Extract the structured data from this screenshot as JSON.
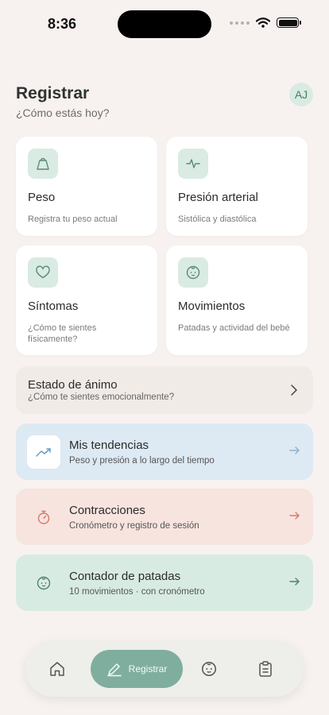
{
  "status": {
    "time": "8:36"
  },
  "header": {
    "title": "Registrar",
    "subtitle": "¿Cómo estás hoy?",
    "avatar": "AJ"
  },
  "grid": [
    {
      "title": "Peso",
      "desc": "Registra tu peso actual",
      "icon": "weight-icon"
    },
    {
      "title": "Presión arterial",
      "desc": "Sistólica y diastólica",
      "icon": "pulse-icon"
    },
    {
      "title": "Síntomas",
      "desc": "¿Cómo te sientes físicamente?",
      "icon": "heart-icon"
    },
    {
      "title": "Movimientos",
      "desc": "Patadas y actividad del bebé",
      "icon": "baby-icon"
    }
  ],
  "mood": {
    "title": "Estado de ánimo",
    "desc": "¿Cómo te sientes emocionalmente?"
  },
  "rows": [
    {
      "title": "Mis tendencias",
      "desc": "Peso y presión a lo largo del tiempo",
      "icon": "trend-icon",
      "color": "#dde9f3"
    },
    {
      "title": "Contracciones",
      "desc": "Cronómetro y registro de sesión",
      "icon": "stopwatch-icon",
      "color": "#f7e4df"
    },
    {
      "title": "Contador de patadas",
      "desc": "10 movimientos · con cronómetro",
      "icon": "baby-icon",
      "color": "#d8ebe3"
    }
  ],
  "tabbar": {
    "active_label": "Registrar"
  },
  "colors": {
    "accent": "#7fae9e",
    "mint": "#d9ebe3",
    "background": "#f7f2f0"
  }
}
